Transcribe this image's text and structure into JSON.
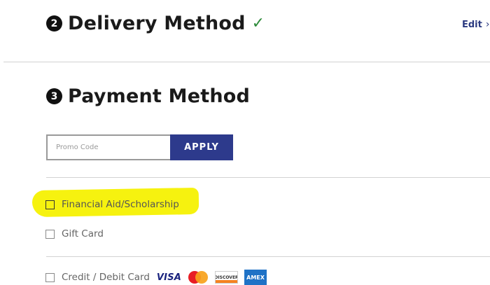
{
  "delivery": {
    "step": "2",
    "title": "Delivery Method",
    "check": "✓",
    "edit_label": "Edit",
    "edit_chevron": "›"
  },
  "payment": {
    "step": "3",
    "title": "Payment Method",
    "promo": {
      "placeholder": "Promo Code",
      "value": ""
    },
    "apply_label": "APPLY",
    "options": [
      {
        "label": "Financial Aid/Scholarship",
        "highlighted": true,
        "checked": false
      },
      {
        "label": "Gift Card",
        "checked": false
      },
      {
        "label": "Credit / Debit Card",
        "checked": false
      }
    ],
    "card_logos": {
      "visa": "VISA",
      "mastercard": "mastercard-logo",
      "discover": "DISCOVER",
      "amex": "AMEX"
    }
  },
  "colors": {
    "primary_button": "#2d3a8c",
    "check": "#2e8b3a",
    "highlight": "#f6f20f",
    "link": "#2b3a80"
  }
}
